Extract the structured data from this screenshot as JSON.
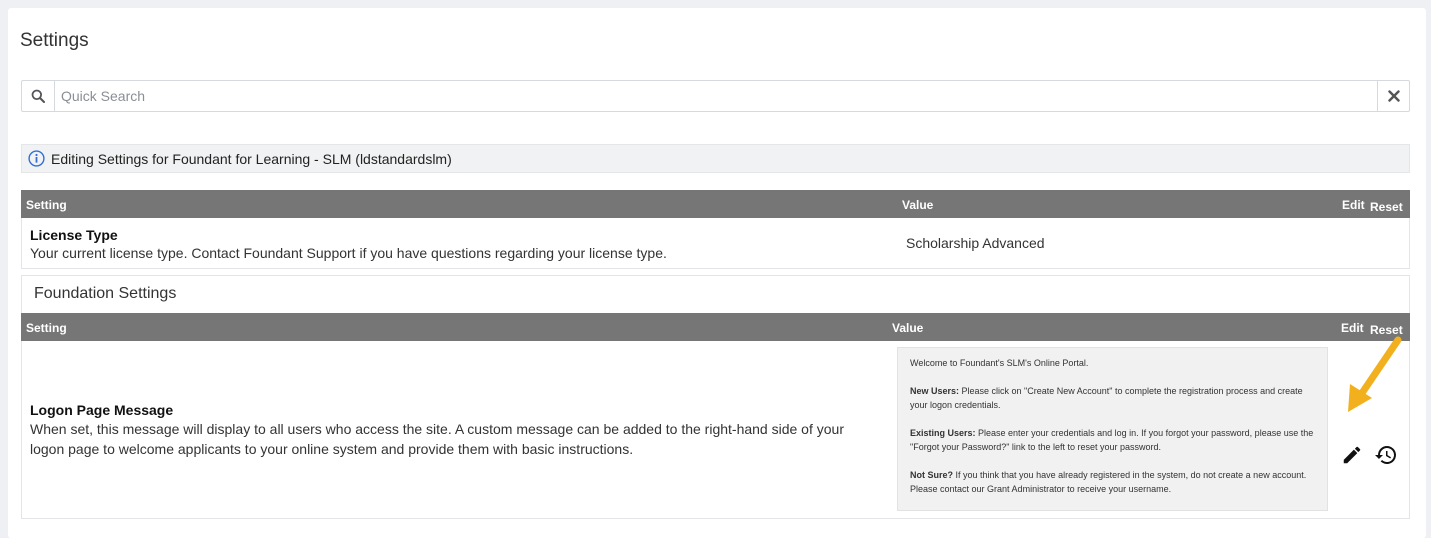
{
  "page": {
    "title": "Settings"
  },
  "search": {
    "placeholder": "Quick Search"
  },
  "info_banner": {
    "text": "Editing Settings for Foundant for Learning - SLM (ldstandardslm)"
  },
  "columns": {
    "setting": "Setting",
    "value": "Value",
    "edit": "Edit",
    "reset": "Reset"
  },
  "general_settings": [
    {
      "name": "License Type",
      "description": "Your current license type. Contact Foundant Support if you have questions regarding your license type.",
      "value": "Scholarship Advanced"
    }
  ],
  "foundation_settings": {
    "title": "Foundation Settings",
    "rows": [
      {
        "name": "Logon Page Message",
        "description": "When set, this message will display to all users who access the site. A custom message can be added to the right-hand side of your logon page to welcome applicants to your online system and provide them with basic instructions.",
        "value_paragraphs": {
          "p1": "Welcome to Foundant's SLM's Online Portal.",
          "p2_bold": "New Users:",
          "p2": " Please click on \"Create New Account\" to complete the registration process and create your logon credentials.",
          "p3_bold": "Existing Users:",
          "p3": " Please enter your credentials and log in. If you forgot your password, please use the \"Forgot your Password?\" link to the left to reset your password.",
          "p4_bold": "Not Sure?",
          "p4": " If you think that you have already registered in the system, do not create a new account. Please contact our Grant Administrator to receive your username."
        }
      }
    ]
  },
  "icons": {
    "search": "search-icon",
    "clear": "close-icon",
    "info": "info-icon",
    "edit": "pencil-icon",
    "reset": "history-icon",
    "annotation": "arrow-icon"
  },
  "colors": {
    "header_bg": "#767676",
    "accent_info": "#2f6fd6",
    "annotation_arrow": "#f2b01e"
  }
}
